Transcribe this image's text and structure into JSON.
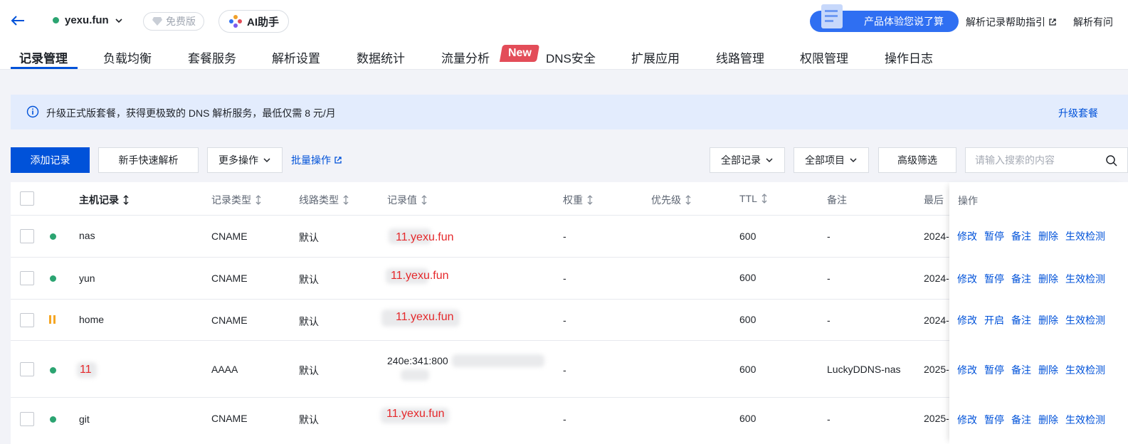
{
  "header": {
    "domain": "yexu.fun",
    "plan_badge": "免费版",
    "ai_button": "AI助手",
    "promo_button": "产品体验您说了算",
    "help_link": "解析记录帮助指引",
    "help_link2": "解析有问"
  },
  "tabs": [
    {
      "label": "记录管理"
    },
    {
      "label": "负载均衡"
    },
    {
      "label": "套餐服务"
    },
    {
      "label": "解析设置"
    },
    {
      "label": "数据统计"
    },
    {
      "label": "流量分析"
    },
    {
      "label": "DNS安全"
    },
    {
      "label": "扩展应用"
    },
    {
      "label": "线路管理"
    },
    {
      "label": "权限管理"
    },
    {
      "label": "操作日志"
    }
  ],
  "new_badge": "New",
  "notice": {
    "text": "升级正式版套餐，获得更极致的 DNS 解析服务，最低仅需 8 元/月",
    "action": "升级套餐"
  },
  "toolbar": {
    "add_record": "添加记录",
    "quick_parse": "新手快速解析",
    "more_actions": "更多操作",
    "batch_actions": "批量操作",
    "all_records": "全部记录",
    "all_projects": "全部项目",
    "advanced_filter": "高级筛选",
    "search_placeholder": "请输入搜索的内容"
  },
  "table": {
    "columns": {
      "host": "主机记录",
      "type": "记录类型",
      "line": "线路类型",
      "value": "记录值",
      "weight": "权重",
      "priority": "优先级",
      "ttl": "TTL",
      "remark": "备注",
      "last": "最后",
      "ops": "操作"
    },
    "rows": [
      {
        "host": "nas",
        "status": "active",
        "type": "CNAME",
        "line": "默认",
        "value": "11.yexu.fun",
        "weight": "-",
        "ttl": "600",
        "remark": "-",
        "last": "2024-",
        "ops": [
          "修改",
          "暂停",
          "备注",
          "删除",
          "生效检测"
        ]
      },
      {
        "host": "yun",
        "status": "active",
        "type": "CNAME",
        "line": "默认",
        "value": "11.yexu.fun",
        "weight": "-",
        "ttl": "600",
        "remark": "-",
        "last": "2024-",
        "ops": [
          "修改",
          "暂停",
          "备注",
          "删除",
          "生效检测"
        ]
      },
      {
        "host": "home",
        "status": "paused",
        "type": "CNAME",
        "line": "默认",
        "value": "11.yexu.fun",
        "weight": "-",
        "ttl": "600",
        "remark": "-",
        "last": "2024-",
        "ops": [
          "修改",
          "开启",
          "备注",
          "删除",
          "生效检测"
        ]
      },
      {
        "host": "11",
        "status": "active",
        "type": "AAAA",
        "line": "默认",
        "value": "240e:341:800",
        "weight": "-",
        "ttl": "600",
        "remark": "LuckyDDNS-nas",
        "last": "2025-",
        "ops": [
          "修改",
          "暂停",
          "备注",
          "删除",
          "生效检测"
        ]
      },
      {
        "host": "git",
        "status": "active",
        "type": "CNAME",
        "line": "默认",
        "value": "11.yexu.fun",
        "weight": "-",
        "ttl": "600",
        "remark": "-",
        "last": "2025-",
        "ops": [
          "修改",
          "暂停",
          "备注",
          "删除",
          "生效检测"
        ]
      }
    ]
  },
  "colors": {
    "primary": "#0052d9",
    "success": "#2ba471",
    "warning": "#f5a623",
    "danger": "#e34d59",
    "background": "#f2f3f8"
  }
}
